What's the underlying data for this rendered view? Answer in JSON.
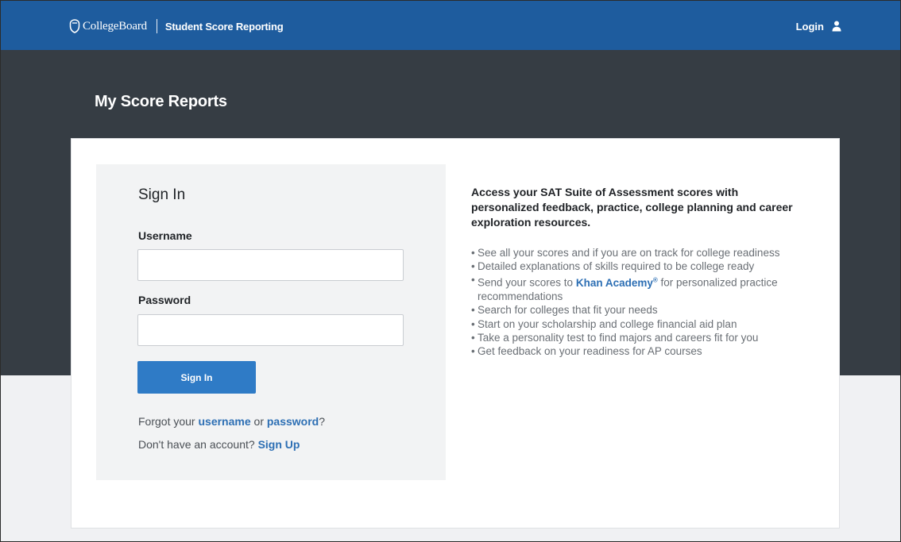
{
  "header": {
    "brand_name": "CollegeBoard",
    "product_name": "Student Score Reporting",
    "login_label": "Login",
    "login_icon": "user-icon"
  },
  "hero": {
    "title": "My Score Reports"
  },
  "signin": {
    "title": "Sign In",
    "username_label": "Username",
    "username_value": "",
    "password_label": "Password",
    "password_value": "",
    "button_label": "Sign In",
    "forgot_prefix": "Forgot your",
    "forgot_username_link": "username",
    "forgot_or": "or",
    "forgot_password_link": "password",
    "forgot_suffix": "?",
    "signup_prefix": "Don't have an account?",
    "signup_link": "Sign Up"
  },
  "info": {
    "heading": "Access your SAT Suite of Assessment scores with personalized feedback, practice, college planning and career exploration resources.",
    "bullet_char": "•",
    "benefits": [
      "See all your scores and if you are on track for college readiness",
      "Detailed explanations of skills required to be college ready",
      {
        "before": "Send your scores to",
        "link": "Khan Academy",
        "reg": "®",
        "after": "for personalized practice recommendations"
      },
      "Search for colleges that fit your needs",
      "Start on your scholarship and college financial aid plan",
      "Take a personality test to find majors and careers fit for you",
      "Get feedback on your readiness for AP courses"
    ]
  },
  "colors": {
    "header_blue": "#1e5c9e",
    "hero_dark": "#363d44",
    "button_blue": "#2f7bc6",
    "link_blue": "#2d6fb4",
    "page_bg": "#f0f1f3"
  }
}
